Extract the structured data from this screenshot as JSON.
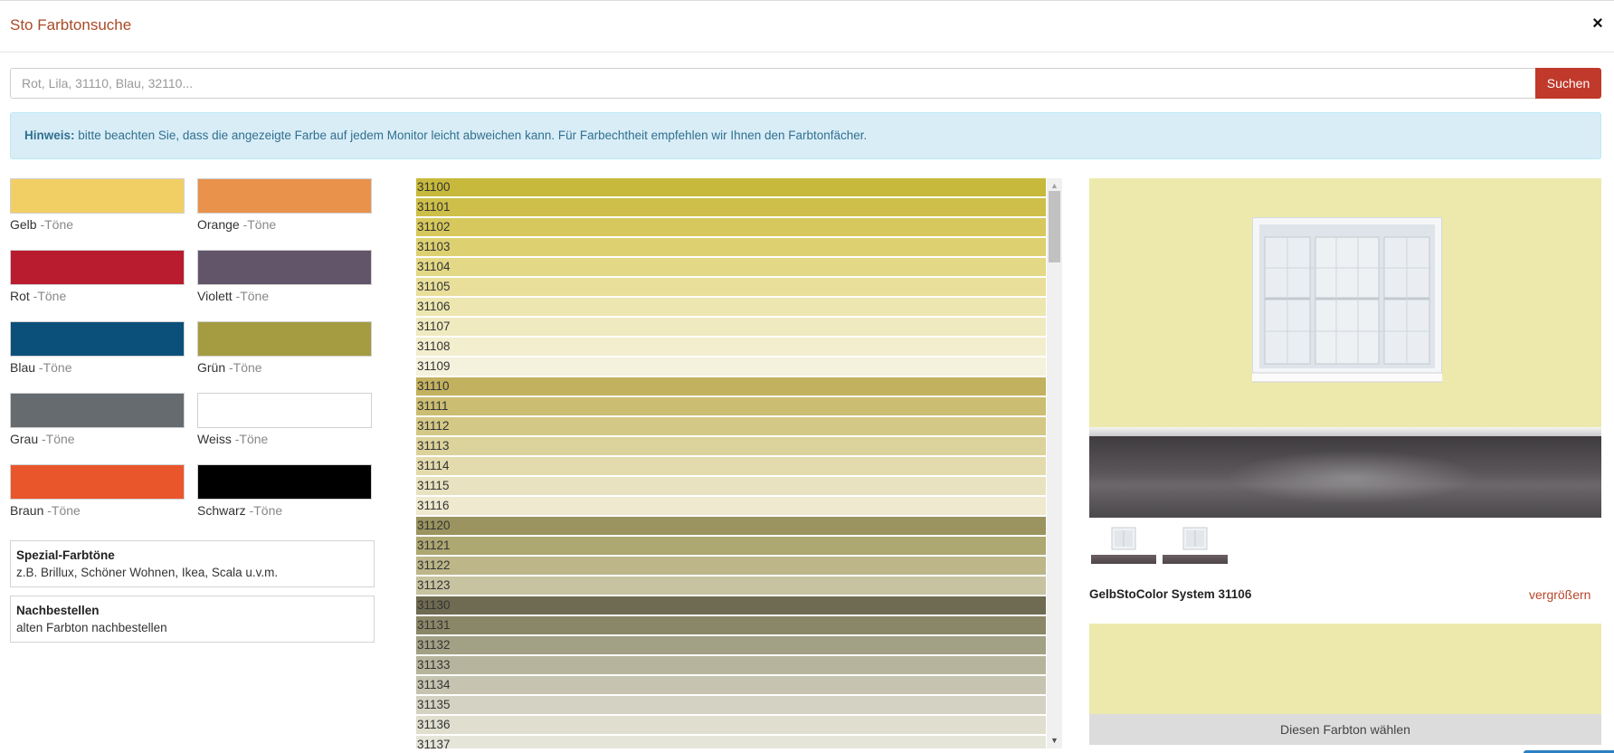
{
  "modal": {
    "title": "Sto Farbtonsuche",
    "close_symbol": "×"
  },
  "search": {
    "placeholder": "Rot, Lila, 31110, Blau, 32110...",
    "value": "",
    "button_label": "Suchen"
  },
  "notice": {
    "label": "Hinweis:",
    "text": " bitte beachten Sie, dass die angezeigte Farbe auf jedem Monitor leicht abweichen kann. Für Farbechtheit empfehlen wir Ihnen den Farbtonfächer."
  },
  "families": [
    {
      "name": "Gelb",
      "suffix": " -Töne",
      "color": "#f2cf64"
    },
    {
      "name": "Orange",
      "suffix": " -Töne",
      "color": "#e8924c"
    },
    {
      "name": "Rot",
      "suffix": " -Töne",
      "color": "#b91c2e"
    },
    {
      "name": "Violett",
      "suffix": " -Töne",
      "color": "#62556a"
    },
    {
      "name": "Blau",
      "suffix": " -Töne",
      "color": "#0b507b"
    },
    {
      "name": "Grün",
      "suffix": " -Töne",
      "color": "#a59b41"
    },
    {
      "name": "Grau",
      "suffix": " -Töne",
      "color": "#656b6e"
    },
    {
      "name": "Weiss",
      "suffix": " -Töne",
      "color": "#ffffff"
    },
    {
      "name": "Braun",
      "suffix": " -Töne",
      "color": "#ea562c"
    },
    {
      "name": "Schwarz",
      "suffix": " -Töne",
      "color": "#000000"
    }
  ],
  "special": {
    "title": "Spezial-Farbtöne",
    "subtitle": "z.B. Brillux, Schöner Wohnen, Ikea, Scala u.v.m."
  },
  "reorder": {
    "title": "Nachbestellen",
    "subtitle": "alten Farbton nachbestellen"
  },
  "shades": [
    {
      "code": "31100",
      "color": "#c7b93b"
    },
    {
      "code": "31101",
      "color": "#cdbf49"
    },
    {
      "code": "31102",
      "color": "#d6c85c"
    },
    {
      "code": "31103",
      "color": "#ddd071"
    },
    {
      "code": "31104",
      "color": "#e3d886"
    },
    {
      "code": "31105",
      "color": "#e9df9b"
    },
    {
      "code": "31106",
      "color": "#ede6b0"
    },
    {
      "code": "31107",
      "color": "#f0eac0"
    },
    {
      "code": "31108",
      "color": "#f2eece"
    },
    {
      "code": "31109",
      "color": "#f4f2dc"
    },
    {
      "code": "31110",
      "color": "#c2b15f"
    },
    {
      "code": "31111",
      "color": "#cbbd72"
    },
    {
      "code": "31112",
      "color": "#d4c886"
    },
    {
      "code": "31113",
      "color": "#dcd29b"
    },
    {
      "code": "31114",
      "color": "#e3dbae"
    },
    {
      "code": "31115",
      "color": "#e9e2c0"
    },
    {
      "code": "31116",
      "color": "#eee9cf"
    },
    {
      "code": "31120",
      "color": "#9b9460"
    },
    {
      "code": "31121",
      "color": "#ada772"
    },
    {
      "code": "31122",
      "color": "#bcb689"
    },
    {
      "code": "31123",
      "color": "#c7c2a0"
    },
    {
      "code": "31130",
      "color": "#6f6b52"
    },
    {
      "code": "31131",
      "color": "#8a8768"
    },
    {
      "code": "31132",
      "color": "#a2a085"
    },
    {
      "code": "31133",
      "color": "#b6b49c"
    },
    {
      "code": "31134",
      "color": "#c6c4b0"
    },
    {
      "code": "31135",
      "color": "#d4d2c2"
    },
    {
      "code": "31136",
      "color": "#dfdecf"
    },
    {
      "code": "31137",
      "color": "#e6e5d9"
    }
  ],
  "preview": {
    "wall_color": "#ede9ad",
    "selected_name": "GelbStoColor System 31106",
    "enlarge_label": "vergrößern",
    "choose_label": "Diesen Farbton wählen"
  }
}
